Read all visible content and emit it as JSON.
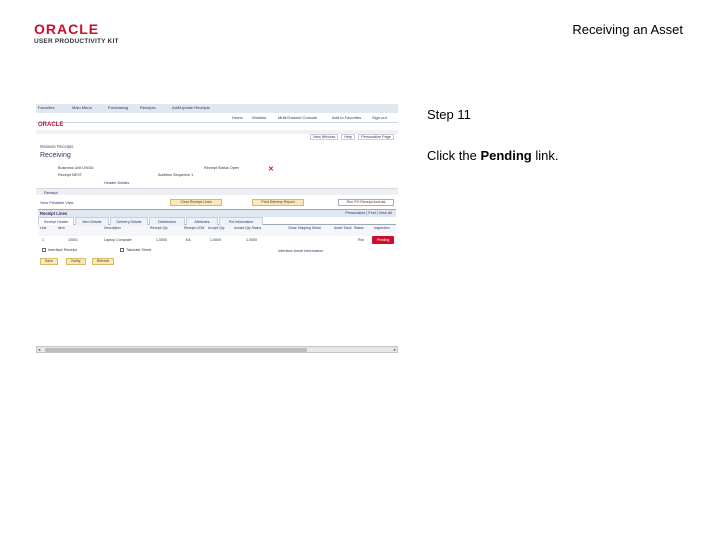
{
  "header": {
    "logo_brand": "ORACLE",
    "logo_sub": "USER PRODUCTIVITY KIT",
    "page_title": "Receiving an Asset"
  },
  "step": {
    "label": "Step 11"
  },
  "instruction": {
    "before": "Click the ",
    "link": "Pending",
    "after": " link."
  },
  "screenshot": {
    "menubar": [
      "Favorites",
      "Main Menu",
      "Purchasing",
      "Receipts",
      "Add/Update Receipts"
    ],
    "navbar": [
      "Home",
      "Worklist",
      "MultiChannel Console",
      "Add to Favorites",
      "Sign out"
    ],
    "oracle": "ORACLE",
    "top_links": [
      "New Window",
      "Help",
      "Personalize Page"
    ],
    "breadcrumb": "Maintain Receipts",
    "heading": "Receiving",
    "fields": {
      "business_unit": "Business Unit  US001",
      "receipt_no": "Receipt NEXT",
      "receipt_status": "Receipt Status  Open",
      "address": "Address Sequence  1",
      "header_details": "Header Details"
    },
    "section_label": "Receipt",
    "buttons": [
      "Clear Receipt Lines",
      "Print Delivery Report",
      "Run PO Receipt Accrual"
    ],
    "view_link": "View Printable View",
    "grid_title": "Receipt Lines",
    "grid_nav": "Personalize | Find | View All",
    "tabs": [
      "Receipt Details",
      "Item Details",
      "Delivery Details",
      "Distribution",
      "Attributes",
      "Put Information"
    ],
    "columns": [
      "Line",
      "Item",
      "Description",
      "Receipt Qty",
      "Receipt UOM",
      "Accept Qty",
      "Accept Qty Status",
      "Close Shipping",
      "Serial",
      "Asset Track",
      "Status",
      "Inspection"
    ],
    "row": [
      "1",
      "10001",
      "Laptop Computer",
      "1.0000",
      "EA",
      "1.0000",
      "1.0000",
      "",
      "",
      "",
      "Rcv",
      "Pending"
    ],
    "checks": [
      "Interface Receipt",
      "Tabulate Sheet"
    ],
    "move_info": "Interface Asset Information",
    "bottom_buttons": [
      "Save",
      "Notify",
      "Refresh"
    ]
  }
}
